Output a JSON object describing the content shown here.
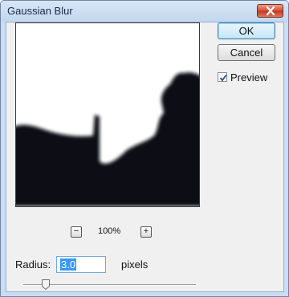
{
  "window": {
    "title": "Gaussian Blur",
    "close_icon": "close-icon"
  },
  "buttons": {
    "ok_label": "OK",
    "cancel_label": "Cancel"
  },
  "preview": {
    "label": "Preview",
    "checked": true
  },
  "zoom": {
    "minus_label": "−",
    "plus_label": "+",
    "level": "100%"
  },
  "radius": {
    "label": "Radius:",
    "value": "3.0",
    "unit": "pixels",
    "slider_fraction": 0.13
  },
  "colors": {
    "titlebar": "#c9dcf2",
    "close_button": "#c33b1f",
    "selection": "#3399ff",
    "preview_dark": "#080c12"
  }
}
